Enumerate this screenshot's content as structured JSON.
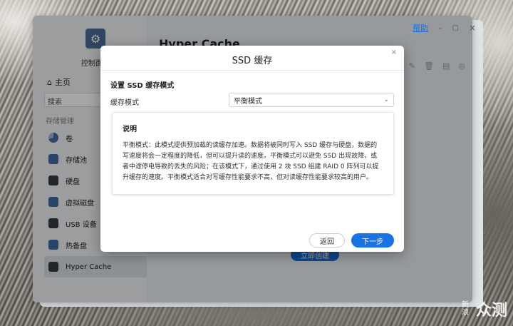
{
  "app": {
    "help_label": "帮助",
    "minimize": "–",
    "maximize": "▢",
    "close": "×",
    "control_panel_label": "控制面",
    "page_title": "Hyper Cache",
    "create_now_label": "立即创建"
  },
  "sidebar": {
    "home_label": "主页",
    "search_placeholder": "搜索",
    "section_label": "存储管理",
    "items": [
      {
        "label": "卷",
        "icon": "volume-icon"
      },
      {
        "label": "存储池",
        "icon": "storage-pool-icon"
      },
      {
        "label": "硬盘",
        "icon": "hdd-icon"
      },
      {
        "label": "虚拟磁盘",
        "icon": "virtual-disk-icon"
      },
      {
        "label": "USB 设备",
        "icon": "usb-icon"
      },
      {
        "label": "热备盘",
        "icon": "hot-spare-icon"
      },
      {
        "label": "Hyper Cache",
        "icon": "hyper-cache-icon"
      }
    ]
  },
  "dialog": {
    "title": "SSD 缓存",
    "close": "×",
    "section_heading": "设置 SSD 缓存模式",
    "field_label": "缓存模式",
    "selected_mode": "平衡模式",
    "description_title": "说明",
    "description_text": "平衡模式：此模式提供预加载的读缓存加速。数据将被同时写入 SSD 缓存与硬盘，数据的写速度将会一定程度的降低，但可以提升读的速度。平衡模式可以避免 SSD 出现故障，或者中途停电导致的丢失的风险；在该模式下，通过使用 2 块 SSD 组建 RAID 0 阵列可以提升缓存的速度。平衡模式适合对写缓存性能要求不高，但对读缓存性能要求较高的用户。",
    "back_label": "返回",
    "next_label": "下一步"
  },
  "watermark": {
    "small": "新浪",
    "big": "众测"
  }
}
